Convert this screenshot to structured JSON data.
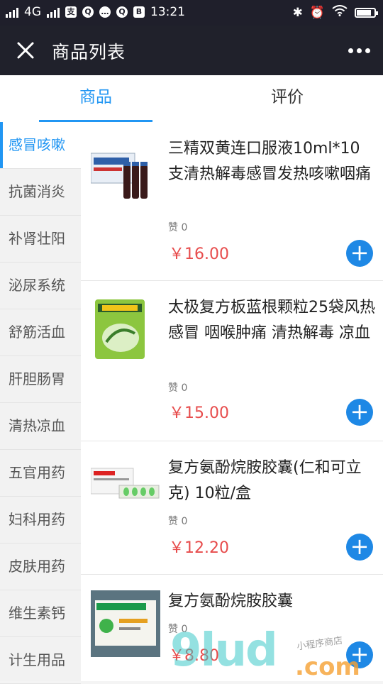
{
  "status_bar": {
    "carrier": "4G",
    "time": "13:21",
    "badges": [
      "支",
      "Q",
      "…",
      "Q",
      "B"
    ]
  },
  "header": {
    "title": "商品列表",
    "close_icon": "close-icon",
    "more_icon": "more-icon"
  },
  "tabs": [
    {
      "label": "商品",
      "active": true
    },
    {
      "label": "评价",
      "active": false
    }
  ],
  "categories": [
    "感冒咳嗽",
    "抗菌消炎",
    "补肾壮阳",
    "泌尿系统",
    "舒筋活血",
    "肝胆肠胃",
    "清热凉血",
    "五官用药",
    "妇科用药",
    "皮肤用药",
    "维生素钙",
    "计生用品"
  ],
  "products": [
    {
      "name": "三精双黄连口服液10ml*10支清热解毒感冒发热咳嗽咽痛",
      "likes": "赞 0",
      "price": "￥16.00"
    },
    {
      "name": "太极复方板蓝根颗粒25袋风热感冒 咽喉肿痛 清热解毒 凉血",
      "likes": "赞 0",
      "price": "￥15.00"
    },
    {
      "name": "复方氨酚烷胺胶囊(仁和可立克) 10粒/盒",
      "likes": "赞 0",
      "price": "￥12.20"
    },
    {
      "name": "复方氨酚烷胺胶囊",
      "likes": "赞 0",
      "price": "￥8.80"
    }
  ],
  "watermark": {
    "main": "9lud",
    "com": ".com",
    "sub": "小程序商店"
  },
  "colors": {
    "accent": "#2196f3",
    "price": "#e74c4c",
    "add_button": "#1e88e5",
    "header_bg": "#20212b"
  }
}
